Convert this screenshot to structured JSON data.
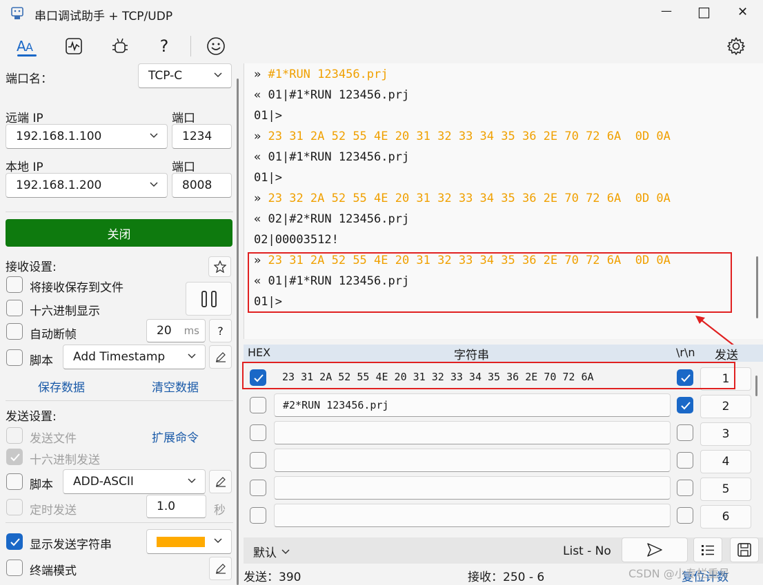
{
  "window": {
    "title": "串口调试助手 + TCP/UDP",
    "min": "—",
    "max": "□",
    "close": "✕"
  },
  "toolbar": {
    "icons": [
      "font-icon",
      "waveform-icon",
      "bug-icon",
      "help-icon",
      "smiley-icon"
    ],
    "help": "?",
    "settings_icon": "gear-icon"
  },
  "left": {
    "port_name_label": "端口名：",
    "port_name_value": "TCP-C",
    "remote_ip_label": "远端 IP",
    "remote_ip_value": "192.168.1.100",
    "remote_port_label": "端口",
    "remote_port_value": "1234",
    "local_ip_label": "本地 IP",
    "local_ip_value": "192.168.1.200",
    "local_port_label": "端口",
    "local_port_value": "8008",
    "close_button": "关闭",
    "recv_settings_label": "接收设置:",
    "save_to_file": "将接收保存到文件",
    "hex_display": "十六进制显示",
    "auto_frame": "自动断帧",
    "auto_frame_value": "20",
    "auto_frame_unit": "ms",
    "auto_frame_help": "?",
    "recv_script_label": "脚本",
    "recv_script_value": "Add Timestamp",
    "save_data": "保存数据",
    "clear_data": "清空数据",
    "send_settings_label": "发送设置:",
    "send_file": "发送文件",
    "ext_cmd": "扩展命令",
    "hex_send": "十六进制发送",
    "send_script_label": "脚本",
    "send_script_value": "ADD-ASCII",
    "timed_send": "定时发送",
    "timed_value": "1.0",
    "timed_unit": "秒",
    "show_send_string": "显示发送字符串",
    "send_color": "#ffaa00",
    "terminal_mode": "终端模式"
  },
  "receive": {
    "lines": [
      {
        "prefix": "»",
        "text": "#1*RUN 123456.prj",
        "color": "orange"
      },
      {
        "prefix": "«",
        "text": "01|#1*RUN 123456.prj",
        "color": "black"
      },
      {
        "prefix": "",
        "text": "01|>",
        "color": "black"
      },
      {
        "prefix": "»",
        "text": "23 31 2A 52 55 4E 20 31 32 33 34 35 36 2E 70 72 6A  0D 0A",
        "color": "orange"
      },
      {
        "prefix": "«",
        "text": "01|#1*RUN 123456.prj",
        "color": "black"
      },
      {
        "prefix": "",
        "text": "01|>",
        "color": "black"
      },
      {
        "prefix": "»",
        "text": "23 32 2A 52 55 4E 20 31 32 33 34 35 36 2E 70 72 6A  0D 0A",
        "color": "orange"
      },
      {
        "prefix": "«",
        "text": "02|#2*RUN 123456.prj",
        "color": "black"
      },
      {
        "prefix": "",
        "text": "02|00003512!",
        "color": "black"
      },
      {
        "prefix": "»",
        "text": "23 31 2A 52 55 4E 20 31 32 33 34 35 36 2E 70 72 6A  0D 0A",
        "color": "orange"
      },
      {
        "prefix": "«",
        "text": "01|#1*RUN 123456.prj",
        "color": "black"
      },
      {
        "prefix": "",
        "text": "01|>",
        "color": "black"
      }
    ]
  },
  "send_table": {
    "headers": {
      "hex": "HEX",
      "string": "字符串",
      "crlf": "\\r\\n",
      "send": "发送"
    },
    "rows": [
      {
        "hex": true,
        "text": "23 31 2A 52 55 4E 20 31 32 33 34 35 36 2E 70 72 6A",
        "crlf": true,
        "num": "1"
      },
      {
        "hex": false,
        "text": "#2*RUN 123456.prj",
        "crlf": true,
        "num": "2"
      },
      {
        "hex": false,
        "text": "",
        "crlf": false,
        "num": "3"
      },
      {
        "hex": false,
        "text": "",
        "crlf": false,
        "num": "4"
      },
      {
        "hex": false,
        "text": "",
        "crlf": false,
        "num": "5"
      },
      {
        "hex": false,
        "text": "",
        "crlf": false,
        "num": "6"
      }
    ]
  },
  "bottom": {
    "profile": "默认",
    "list_mode": "List - No"
  },
  "status": {
    "sent": "发送：390",
    "received": "接收：250 - 6",
    "reset": "复位计数",
    "watermark": "CSDN @小专栏重号"
  },
  "colors": {
    "accent": "#1a68c7",
    "close_button": "#0e7a0e",
    "highlight": "#e02020",
    "hex_text": "#f0a000"
  }
}
